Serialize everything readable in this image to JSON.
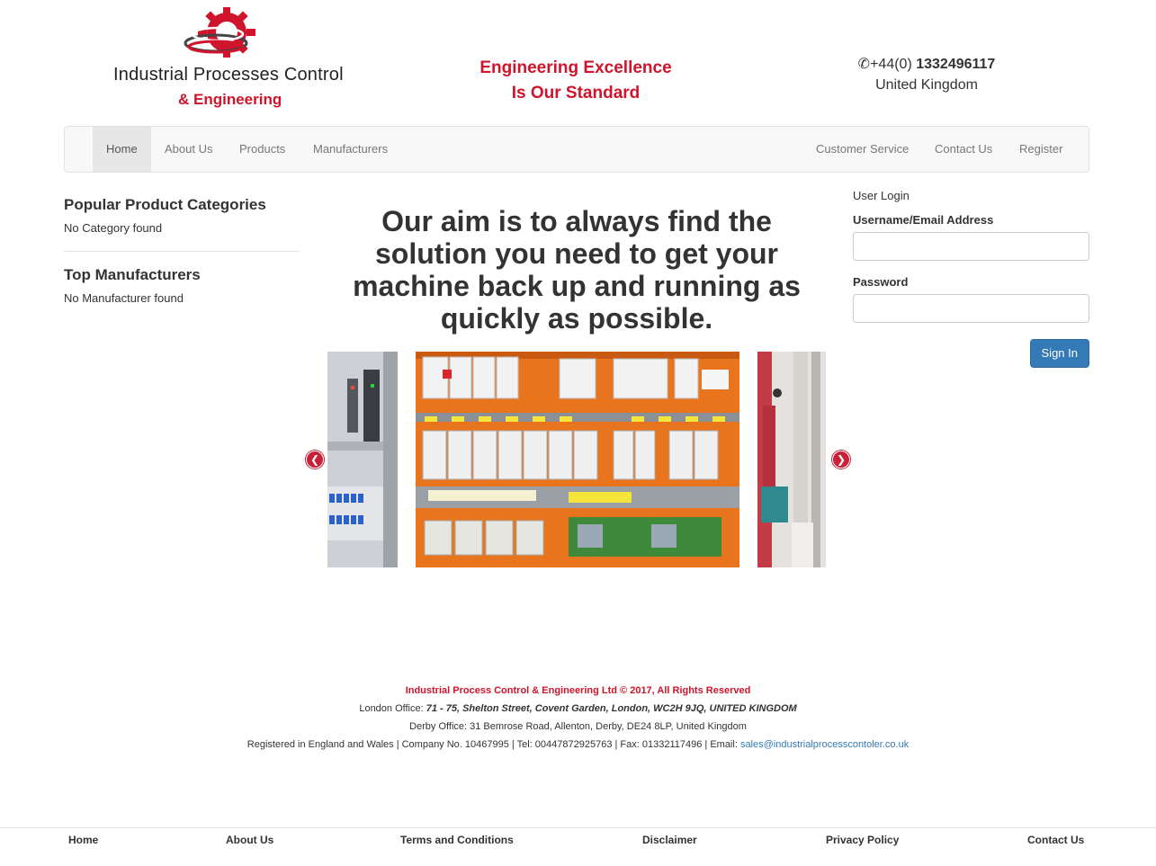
{
  "header": {
    "logo_line1": "Industrial Processes Control",
    "logo_line2": "& Engineering",
    "tagline_line1": "Engineering Excellence",
    "tagline_line2": "Is Our Standard",
    "phone_prefix": "+44(0) ",
    "phone_number": "1332496117",
    "country": "United Kingdom",
    "brand_color": "#d0142b"
  },
  "nav": {
    "left": [
      "Home",
      "About Us",
      "Products",
      "Manufacturers"
    ],
    "right": [
      "Customer Service",
      "Contact Us",
      "Register"
    ],
    "active": "Home"
  },
  "sidebar": {
    "categories_title": "Popular Product Categories",
    "categories_empty": "No Category found",
    "manufacturers_title": "Top Manufacturers",
    "manufacturers_empty": "No Manufacturer found"
  },
  "main": {
    "headline": "Our aim is to always find the solution you need to get your machine back up and running as quickly as possible.",
    "carousel": {
      "prev_icon": "chevron-left-icon",
      "next_icon": "chevron-right-icon"
    }
  },
  "login": {
    "title": "User Login",
    "username_label": "Username/Email Address",
    "password_label": "Password",
    "signin_label": "Sign In"
  },
  "footer": {
    "copyright": "Industrial Process Control & Engineering Ltd © 2017, All Rights Reserved",
    "london_label": "London Office: ",
    "london_address": "71 - 75, Shelton Street, Covent Garden, London, WC2H 9JQ, UNITED KINGDOM",
    "derby": "Derby Office: 31 Bemrose Road, Allenton, Derby, DE24 8LP, United Kingdom",
    "registered": "Registered in England and Wales | Company No. 10467995 | Tel: 00447872925763 | Fax: 01332117496 | Email: ",
    "email": "sales@industrialprocesscontoler.co.uk"
  },
  "bottom_nav": [
    "Home",
    "About Us",
    "Terms and Conditions",
    "Disclaimer",
    "Privacy Policy",
    "Contact Us"
  ]
}
